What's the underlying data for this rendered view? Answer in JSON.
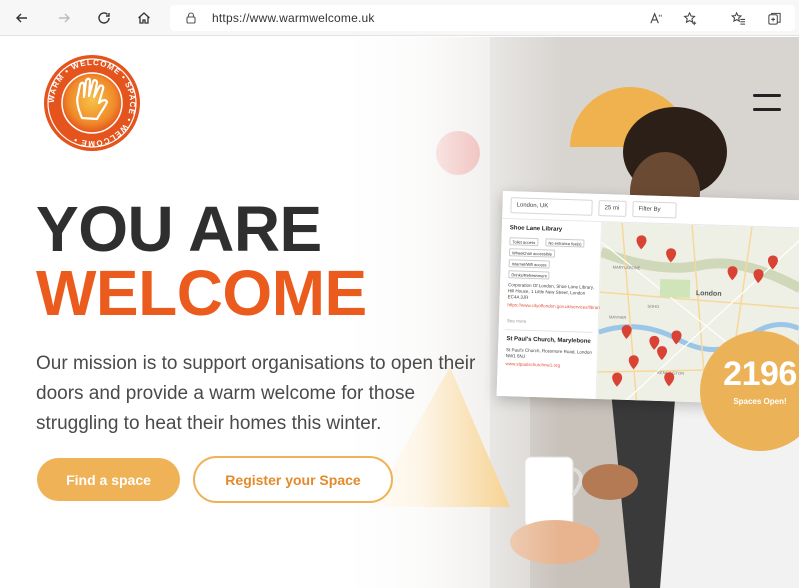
{
  "browser": {
    "url": "https://www.warmwelcome.uk",
    "read_aloud": "Aᵁ"
  },
  "logo": {
    "ring_text": "WARM • WELCOME • SPACE • WELCOME •"
  },
  "hero": {
    "headline_line1": "YOU ARE",
    "headline_line2": "WELCOME",
    "mission": "Our mission is to support organisations to open their doors and provide a warm welcome for those struggling to heat their homes this winter.",
    "primary_button": "Find a space",
    "secondary_button": "Register your Space"
  },
  "map_card": {
    "search_location": "London, UK",
    "radius": "25 mi",
    "filter": "Filter By",
    "venue1_title": "Shoe Lane Library",
    "venue1_chips": [
      "Toilet access",
      "No entrance fee(s)",
      "Wheelchair accessible",
      "Internet/Wifi access",
      "Drinks/Refreshment"
    ],
    "venue1_address": "Corporation Of London, Shoe Lane Library, Hill House, 1 Little New Street, London EC4A 3JR",
    "venue1_link": "https://www.cityoflondon.gov.uk/services/libraries",
    "venue1_more": "See more",
    "venue2_title": "St Paul's Church, Marylebone",
    "venue2_address": "St Paul's Church, Rossmore Road, London NW1 6NJ",
    "venue2_link": "www.stpaulschurchnw1.org",
    "map_label": "London",
    "map_area_labels": [
      "MARYLEBONE",
      "SOHO",
      "MAYFAIR",
      "BERMONDSEY",
      "KENNINGTON"
    ]
  },
  "counter": {
    "number": "2196",
    "label": "Spaces Open!"
  },
  "colors": {
    "orange": "#ec5b1e",
    "amber": "#efb256",
    "dark_text": "#2f2f2f"
  }
}
